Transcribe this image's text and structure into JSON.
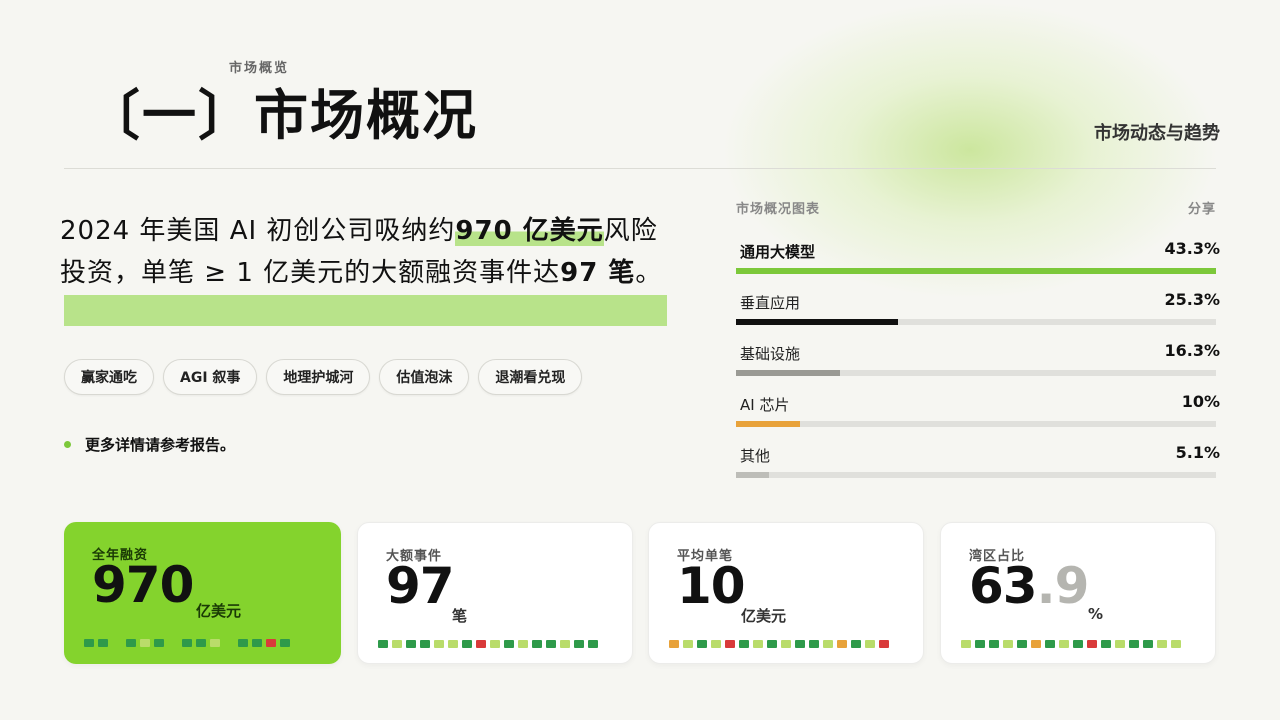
{
  "header": {
    "kicker": "市场概览",
    "title": "〔一〕市场概况",
    "subtitle": "市场动态与趋势"
  },
  "lead": {
    "part1": "2024 年美国 AI 初创公司吸纳约",
    "highlight1": "970 亿美元",
    "part2": "风险投资，单笔 ≥ 1 亿美元的大额融资事件达",
    "highlight2": "97 笔",
    "part3": "。"
  },
  "tags": [
    "赢家通吃",
    "AGI 叙事",
    "地理护城河",
    "估值泡沫",
    "退潮看兑现"
  ],
  "note": "更多详情请参考报告。",
  "panel": {
    "title": "市场概况图表",
    "action": "分享"
  },
  "chart_data": {
    "type": "bar",
    "title": "市场概况图表",
    "categories": [
      "通用大模型",
      "垂直应用",
      "基础设施",
      "AI 芯片",
      "其他"
    ],
    "values": [
      43.3,
      25.3,
      16.3,
      10,
      5.1
    ],
    "labels": [
      "43.3%",
      "25.3%",
      "16.3%",
      "10%",
      "5.1%"
    ],
    "colors": [
      "#7cc83a",
      "#111111",
      "#9a9a94",
      "#e8a23a",
      "#bdbdb8"
    ],
    "ylim": [
      0,
      75
    ]
  },
  "cards": [
    {
      "label": "全年融资",
      "value": "970",
      "decimal": "",
      "unit": "亿美元"
    },
    {
      "label": "大额事件",
      "value": "97",
      "decimal": "",
      "unit": "笔"
    },
    {
      "label": "平均单笔",
      "value": "10",
      "decimal": "",
      "unit": "亿美元"
    },
    {
      "label": "湾区占比",
      "value": "63",
      "decimal": ".9",
      "unit": "%"
    }
  ],
  "colors": {
    "accent": "#84d32d",
    "highlight": "#b8e38a",
    "square_palette": [
      "#2e9a4a",
      "#7cc83a",
      "#e8a23a",
      "#d93a3a"
    ]
  }
}
